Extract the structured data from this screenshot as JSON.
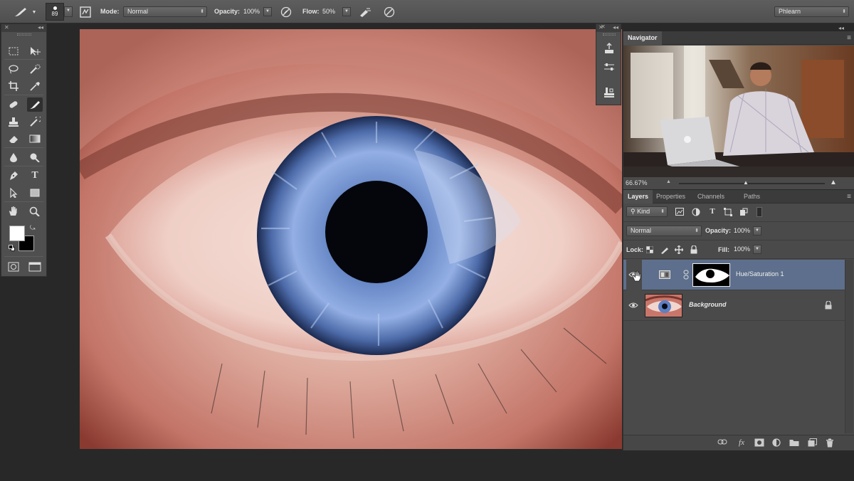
{
  "options_bar": {
    "brush_size": "89",
    "mode_label": "Mode:",
    "mode_value": "Normal",
    "opacity_label": "Opacity:",
    "opacity_value": "100%",
    "flow_label": "Flow:",
    "flow_value": "50%",
    "workspace_value": "Phlearn"
  },
  "tools": [
    "rectangular-marquee-icon",
    "move-icon",
    "lasso-icon",
    "quick-selection-icon",
    "crop-icon",
    "eyedropper-icon",
    "healing-brush-icon",
    "brush-icon",
    "clone-stamp-icon",
    "history-brush-icon",
    "eraser-icon",
    "gradient-icon",
    "blur-icon",
    "dodge-icon",
    "pen-icon",
    "type-icon",
    "path-selection-icon",
    "rectangle-shape-icon",
    "hand-icon",
    "zoom-icon"
  ],
  "navigator": {
    "tab_label": "Navigator",
    "zoom_value": "66.67%"
  },
  "layers_panel": {
    "tabs": [
      "Layers",
      "Properties",
      "Channels",
      "Paths"
    ],
    "filter_label": "Kind",
    "blend_mode": "Normal",
    "opacity_label": "Opacity:",
    "opacity_value": "100%",
    "lock_label": "Lock:",
    "fill_label": "Fill:",
    "fill_value": "100%",
    "layers": [
      {
        "name": "Hue/Saturation 1",
        "selected": true
      },
      {
        "name": "Background",
        "selected": false
      }
    ]
  },
  "colors": {
    "accent_selected_layer": "#5d6f8c",
    "panel_bg": "#4a4a4a",
    "app_bg": "#282828"
  }
}
